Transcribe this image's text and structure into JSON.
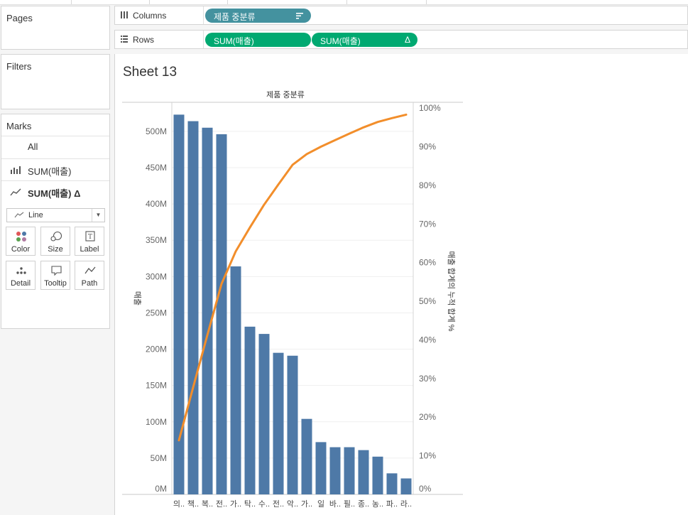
{
  "panels": {
    "pages": "Pages",
    "filters": "Filters",
    "marks": "Marks"
  },
  "marks_card": {
    "rows": [
      {
        "label": "All",
        "icon": "none"
      },
      {
        "label": "SUM(매출)",
        "icon": "bar-chart-icon"
      },
      {
        "label": "SUM(매출) Δ",
        "icon": "line-chart-icon"
      }
    ],
    "mark_type": "Line",
    "buttons": [
      "Color",
      "Size",
      "Label",
      "Detail",
      "Tooltip",
      "Path"
    ]
  },
  "shelves": {
    "columns_label": "Columns",
    "rows_label": "Rows",
    "columns_pill": "제품 중분류",
    "rows_pills": [
      "SUM(매출)",
      "SUM(매출)"
    ],
    "rows_pill_2_badge": "Δ"
  },
  "sheet": {
    "title": "Sheet 13"
  },
  "colors": {
    "bar": "#4e79a7",
    "line": "#f28e2b",
    "dimension_pill": "#44929f",
    "measure_pill": "#00a971"
  },
  "chart_data": {
    "type": "bar",
    "title": "제품 중분류",
    "xlabel": "",
    "ylabel": "매출",
    "y2label": "매출 합계의 누적 합계 %",
    "categories": [
      "의..",
      "책..",
      "복..",
      "전..",
      "가..",
      "탁..",
      "수..",
      "전..",
      "악..",
      "가..",
      "일",
      "바..",
      "필..",
      "종..",
      "농..",
      "파..",
      "라.."
    ],
    "series": [
      {
        "name": "SUM(매출)",
        "type": "bar",
        "axis": "left",
        "values": [
          523,
          514,
          505,
          496,
          314,
          231,
          221,
          195,
          191,
          104,
          72,
          65,
          65,
          61,
          52,
          29,
          22
        ]
      },
      {
        "name": "SUM(매출) Δ",
        "type": "line",
        "axis": "right",
        "values": [
          14.0,
          27.7,
          41.2,
          54.5,
          62.9,
          69.1,
          75.0,
          80.2,
          85.3,
          88.1,
          90.0,
          91.7,
          93.4,
          95.0,
          96.4,
          97.4,
          98.3
        ]
      }
    ],
    "ylim": [
      0,
      540
    ],
    "yticks": [
      0,
      50,
      100,
      150,
      200,
      250,
      300,
      350,
      400,
      450,
      500
    ],
    "ytick_labels": [
      "0M",
      "50M",
      "100M",
      "150M",
      "200M",
      "250M",
      "300M",
      "350M",
      "400M",
      "450M",
      "500M"
    ],
    "y2lim": [
      0,
      101.5
    ],
    "y2ticks": [
      0,
      10,
      20,
      30,
      40,
      50,
      60,
      70,
      80,
      90,
      100
    ],
    "y2tick_labels": [
      "0%",
      "10%",
      "20%",
      "30%",
      "40%",
      "50%",
      "60%",
      "70%",
      "80%",
      "90%",
      "100%"
    ],
    "grid": true
  }
}
